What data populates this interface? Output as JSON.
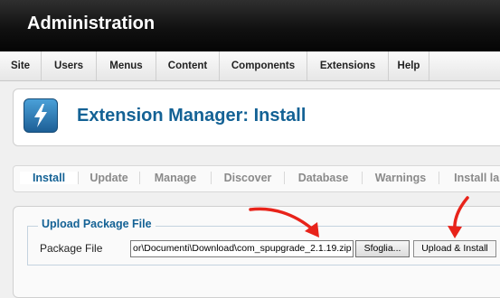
{
  "header": {
    "title": "Administration"
  },
  "menu": [
    "Site",
    "Users",
    "Menus",
    "Content",
    "Components",
    "Extensions",
    "Help"
  ],
  "page": {
    "title": "Extension Manager: Install",
    "icon": "lightning-bolt-icon"
  },
  "tabs": [
    "Install",
    "Update",
    "Manage",
    "Discover",
    "Database",
    "Warnings",
    "Install lan"
  ],
  "upload": {
    "legend": "Upload Package File",
    "label": "Package File",
    "file_value": "or\\Documenti\\Download\\com_spupgrade_2.1.19.zip",
    "browse_label": "Sfoglia...",
    "install_label": "Upload & Install"
  },
  "colors": {
    "accent": "#146295",
    "arrow": "#e8231a",
    "header": "#111111"
  }
}
